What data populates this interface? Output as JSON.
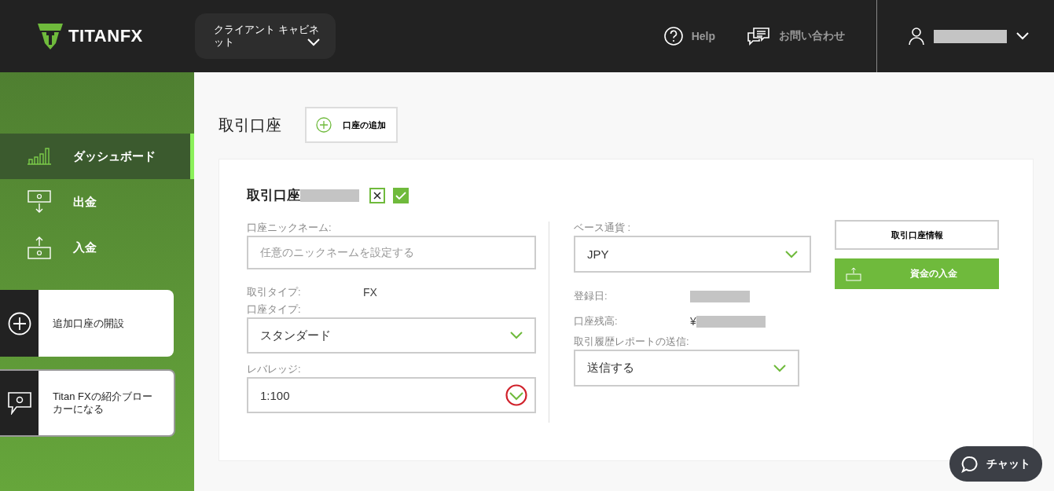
{
  "header": {
    "logo": "TITANFX",
    "cabinet_menu": "クライアント キャビネット",
    "help": "Help",
    "contact": "お問い合わせ"
  },
  "sidebar": {
    "items": [
      {
        "label": "ダッシュボード",
        "selected": true
      },
      {
        "label": "出金",
        "selected": false
      },
      {
        "label": "入金",
        "selected": false
      }
    ],
    "cards": [
      {
        "label": "追加口座の開設"
      },
      {
        "label": "Titan FXの紹介ブローカーになる"
      }
    ]
  },
  "page": {
    "title": "取引口座",
    "add_button": "口座の追加"
  },
  "account": {
    "title": "取引口座",
    "left_fields": [
      {
        "kind": "input",
        "label": "口座ニックネーム:",
        "placeholder": "任意のニックネームを設定する"
      },
      {
        "kind": "info",
        "label": "取引タイプ:",
        "value": "FX"
      },
      {
        "kind": "select",
        "label": "口座タイプ:",
        "value": "スタンダード",
        "highlighted": false
      },
      {
        "kind": "select",
        "label": "レバレッジ:",
        "value": "1:100",
        "highlighted": true
      }
    ],
    "right_fields": [
      {
        "kind": "select",
        "label": "ベース通貨 :",
        "value": "JPY",
        "highlighted": false
      },
      {
        "kind": "masked",
        "label": "登録日:"
      },
      {
        "kind": "masked",
        "label": "口座残高:",
        "value": "¥"
      },
      {
        "kind": "select",
        "label": "取引履歴レポートの送信:",
        "value": "送信する",
        "highlighted": false,
        "narrow": true
      }
    ],
    "info_button": "取引口座情報",
    "deposit_button": "資金の入金"
  },
  "chat_button": "チャット"
}
